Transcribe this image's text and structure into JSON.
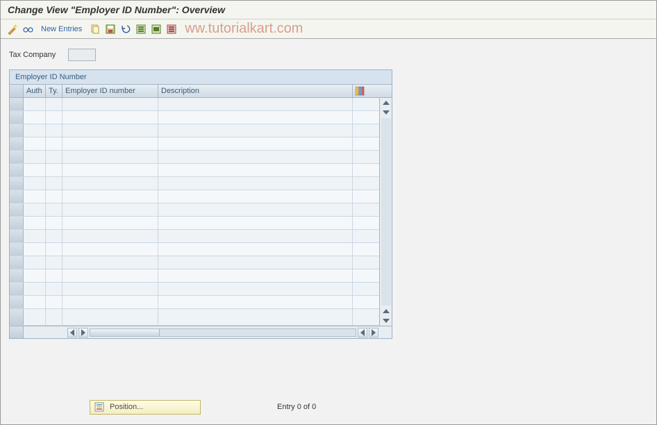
{
  "title": "Change View \"Employer ID Number\": Overview",
  "toolbar": {
    "new_entries_label": "New Entries"
  },
  "watermark_text": "ww.tutorialkart.com",
  "form": {
    "tax_company_label": "Tax Company",
    "tax_company_value": ""
  },
  "table": {
    "panel_title": "Employer ID Number",
    "columns": {
      "auth": "Auth",
      "ty": "Ty.",
      "ein": "Employer ID number",
      "desc": "Description"
    },
    "row_count": 17,
    "rows": []
  },
  "footer": {
    "position_label": "Position...",
    "entry_text": "Entry 0 of 0"
  },
  "icons": {
    "wand": "wand-icon",
    "glasses": "glasses-icon",
    "copy": "copy-icon",
    "save_variant": "save-variant-icon",
    "undo": "undo-icon",
    "select_all": "select-all-icon",
    "select_block": "select-block-icon",
    "deselect": "deselect-icon",
    "config": "table-settings-icon",
    "position": "position-icon"
  }
}
